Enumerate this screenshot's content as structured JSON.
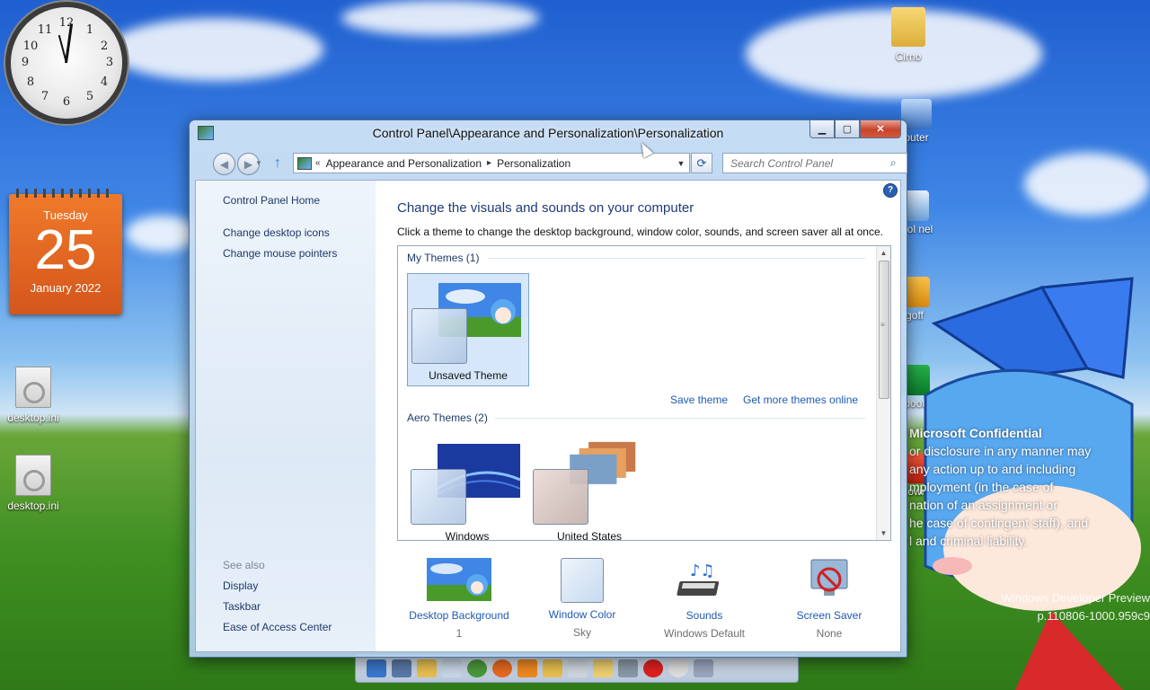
{
  "desktop": {
    "clock_numbers": [
      "12",
      "1",
      "2",
      "3",
      "4",
      "5",
      "6",
      "7",
      "8",
      "9",
      "10",
      "11"
    ],
    "calendar": {
      "weekday": "Tuesday",
      "day": "25",
      "month_year": "January 2022"
    },
    "icons": [
      {
        "label": "desktop.ini"
      },
      {
        "label": "desktop.ini"
      },
      {
        "label": "Cirno"
      },
      {
        "label": "puter"
      },
      {
        "label": "ntrol nel"
      },
      {
        "label": "goff"
      },
      {
        "label": "boot"
      },
      {
        "label": "down"
      }
    ],
    "confidential": {
      "heading": "Microsoft Confidential",
      "lines": [
        "or disclosure in any manner may",
        "any action up to and including",
        "mployment (in the case of",
        "nation of an assignment or",
        "he case of contingent staff), and",
        "l and criminal liability."
      ]
    },
    "watermark": {
      "line1": "Windows Developer Preview",
      "line2": "p.110806-1000.959c9"
    }
  },
  "window": {
    "title": "Control Panel\\Appearance and Personalization\\Personalization",
    "caption": {
      "minimize": "▁",
      "maximize": "▢",
      "close": "✕"
    },
    "nav": {
      "back": "◀",
      "forward": "▶",
      "dropdown": "▼",
      "up": "↑",
      "address": {
        "prefix": "«",
        "segments": [
          "Appearance and Personalization",
          "Personalization"
        ],
        "sep": "▸",
        "dropdown": "▼"
      },
      "refresh": "⟳",
      "search_placeholder": "Search Control Panel",
      "search_icon": "⌕"
    },
    "left_pane": {
      "links": [
        "Control Panel Home",
        "Change desktop icons",
        "Change mouse pointers"
      ],
      "see_also_label": "See also",
      "see_also": [
        "Display",
        "Taskbar",
        "Ease of Access Center"
      ]
    },
    "help": "?",
    "main": {
      "title": "Change the visuals and sounds on your computer",
      "description": "Click a theme to change the desktop background, window color, sounds, and screen saver all at once.",
      "my_themes_label": "My Themes (1)",
      "my_themes": [
        {
          "name": "Unsaved Theme",
          "selected": true
        }
      ],
      "save_theme": "Save theme",
      "get_more": "Get more themes online",
      "aero_label": "Aero Themes (2)",
      "aero_themes": [
        {
          "name": "Windows"
        },
        {
          "name": "United States"
        }
      ],
      "scroll_up": "▲",
      "scroll_grip": "≡",
      "scroll_down": "▼",
      "bottom": [
        {
          "label": "Desktop Background",
          "value": "1"
        },
        {
          "label": "Window Color",
          "value": "Sky"
        },
        {
          "label": "Sounds",
          "value": "Windows Default"
        },
        {
          "label": "Screen Saver",
          "value": "None"
        }
      ]
    }
  }
}
